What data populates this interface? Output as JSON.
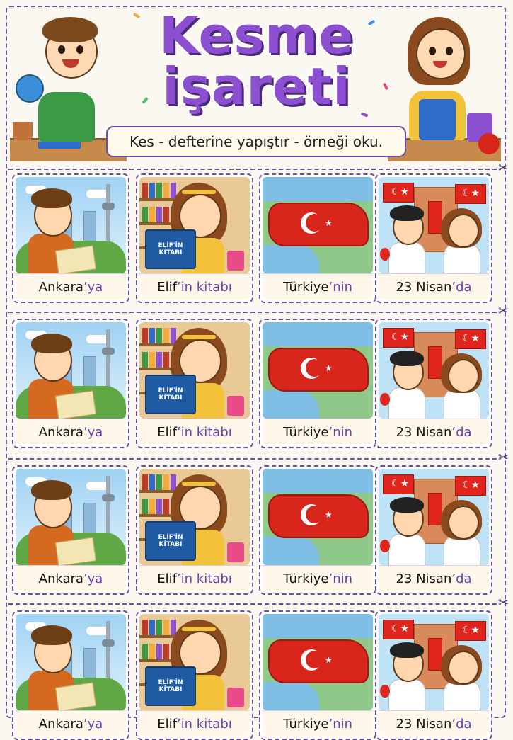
{
  "title": {
    "line1": "Kesme",
    "line2": "işareti"
  },
  "instruction": "Kes - defterine yapıştır - örneği oku.",
  "cards": [
    {
      "id": "ankara",
      "stem": "Ankara",
      "suffix": "’ya",
      "scene": "boy-city-map"
    },
    {
      "id": "elif",
      "stem": "Elif",
      "suffix": "’in kitabı",
      "scene": "girl-reading",
      "book_text": "ELİF'İN KİTABI"
    },
    {
      "id": "turkiye",
      "stem": "Türkiye",
      "suffix": "’nin",
      "scene": "turkey-map"
    },
    {
      "id": "nisan",
      "stem": "23 Nisan",
      "suffix": "’da",
      "scene": "kids-flags-school"
    }
  ],
  "rows": 4,
  "icons": {
    "cut": "scissors-icon"
  },
  "colors": {
    "accent": "#8c4fcf",
    "border": "#6b4fa0",
    "flag_red": "#e0261c"
  }
}
